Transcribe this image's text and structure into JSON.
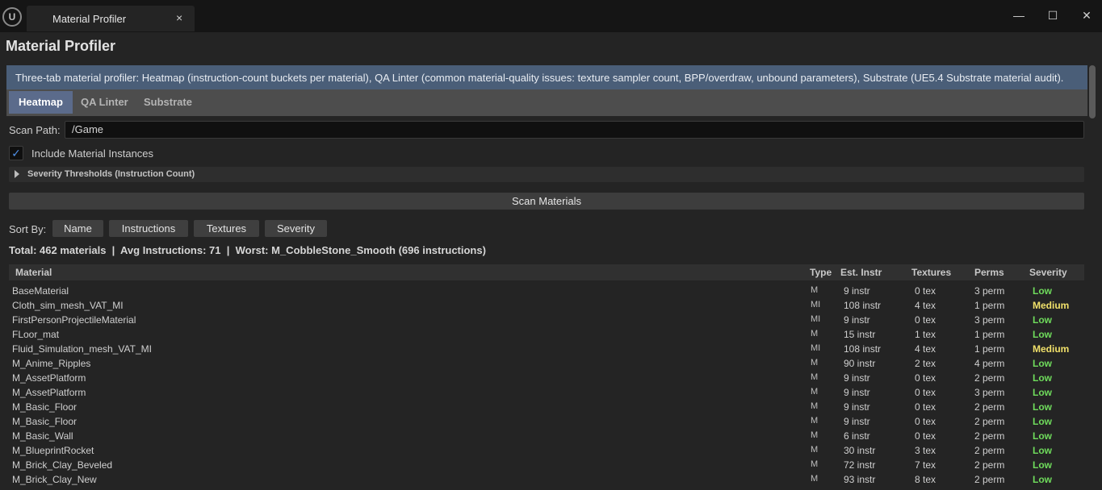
{
  "window": {
    "tab_title": "Material Profiler",
    "tab_close": "×",
    "app_logo": "U",
    "minimize": "—",
    "maximize": "☐",
    "close": "✕"
  },
  "panel": {
    "title": "Material Profiler",
    "description": "Three-tab material profiler: Heatmap (instruction-count buckets per material), QA Linter (common material-quality issues: texture sampler count, BPP/overdraw, unbound parameters), Substrate (UE5.4 Substrate material audit).",
    "tabs": [
      {
        "label": "Heatmap",
        "active": true
      },
      {
        "label": "QA Linter",
        "active": false
      },
      {
        "label": "Substrate",
        "active": false
      }
    ]
  },
  "scan": {
    "path_label": "Scan Path:",
    "path_value": "/Game",
    "include_instances_label": "Include Material Instances",
    "include_instances_checked": true,
    "check_mark": "✓",
    "thresholds_label": "Severity Thresholds (Instruction Count)",
    "scan_button": "Scan Materials"
  },
  "sort": {
    "label": "Sort By:",
    "buttons": [
      "Name",
      "Instructions",
      "Textures",
      "Severity"
    ]
  },
  "summary": "Total: 462 materials  |  Avg Instructions: 71  |  Worst: M_CobbleStone_Smooth (696 instructions)",
  "table": {
    "headers": [
      "Material",
      "Type",
      "Est. Instr",
      "Textures",
      "Perms",
      "Severity"
    ],
    "rows": [
      {
        "name": "BaseMaterial",
        "type": "M",
        "instr": "9 instr",
        "tex": "0 tex",
        "perm": "3 perm",
        "sev": "Low"
      },
      {
        "name": "Cloth_sim_mesh_VAT_MI",
        "type": "MI",
        "instr": "108 instr",
        "tex": "4 tex",
        "perm": "1 perm",
        "sev": "Medium"
      },
      {
        "name": "FirstPersonProjectileMaterial",
        "type": "MI",
        "instr": "9 instr",
        "tex": "0 tex",
        "perm": "3 perm",
        "sev": "Low"
      },
      {
        "name": "FLoor_mat",
        "type": "M",
        "instr": "15 instr",
        "tex": "1 tex",
        "perm": "1 perm",
        "sev": "Low"
      },
      {
        "name": "Fluid_Simulation_mesh_VAT_MI",
        "type": "MI",
        "instr": "108 instr",
        "tex": "4 tex",
        "perm": "1 perm",
        "sev": "Medium"
      },
      {
        "name": "M_Anime_Ripples",
        "type": "M",
        "instr": "90 instr",
        "tex": "2 tex",
        "perm": "4 perm",
        "sev": "Low"
      },
      {
        "name": "M_AssetPlatform",
        "type": "M",
        "instr": "9 instr",
        "tex": "0 tex",
        "perm": "2 perm",
        "sev": "Low"
      },
      {
        "name": "M_AssetPlatform",
        "type": "M",
        "instr": "9 instr",
        "tex": "0 tex",
        "perm": "3 perm",
        "sev": "Low"
      },
      {
        "name": "M_Basic_Floor",
        "type": "M",
        "instr": "9 instr",
        "tex": "0 tex",
        "perm": "2 perm",
        "sev": "Low"
      },
      {
        "name": "M_Basic_Floor",
        "type": "M",
        "instr": "9 instr",
        "tex": "0 tex",
        "perm": "2 perm",
        "sev": "Low"
      },
      {
        "name": "M_Basic_Wall",
        "type": "M",
        "instr": "6 instr",
        "tex": "0 tex",
        "perm": "2 perm",
        "sev": "Low"
      },
      {
        "name": "M_BlueprintRocket",
        "type": "M",
        "instr": "30 instr",
        "tex": "3 tex",
        "perm": "2 perm",
        "sev": "Low"
      },
      {
        "name": "M_Brick_Clay_Beveled",
        "type": "M",
        "instr": "72 instr",
        "tex": "7 tex",
        "perm": "2 perm",
        "sev": "Low"
      },
      {
        "name": "M_Brick_Clay_New",
        "type": "M",
        "instr": "93 instr",
        "tex": "8 tex",
        "perm": "2 perm",
        "sev": "Low"
      }
    ]
  },
  "colors": {
    "severity_low": "#6fdc5c",
    "severity_medium": "#f0e06a",
    "accent_tab": "#5b6b8b",
    "description_bg": "#4a5e78"
  }
}
